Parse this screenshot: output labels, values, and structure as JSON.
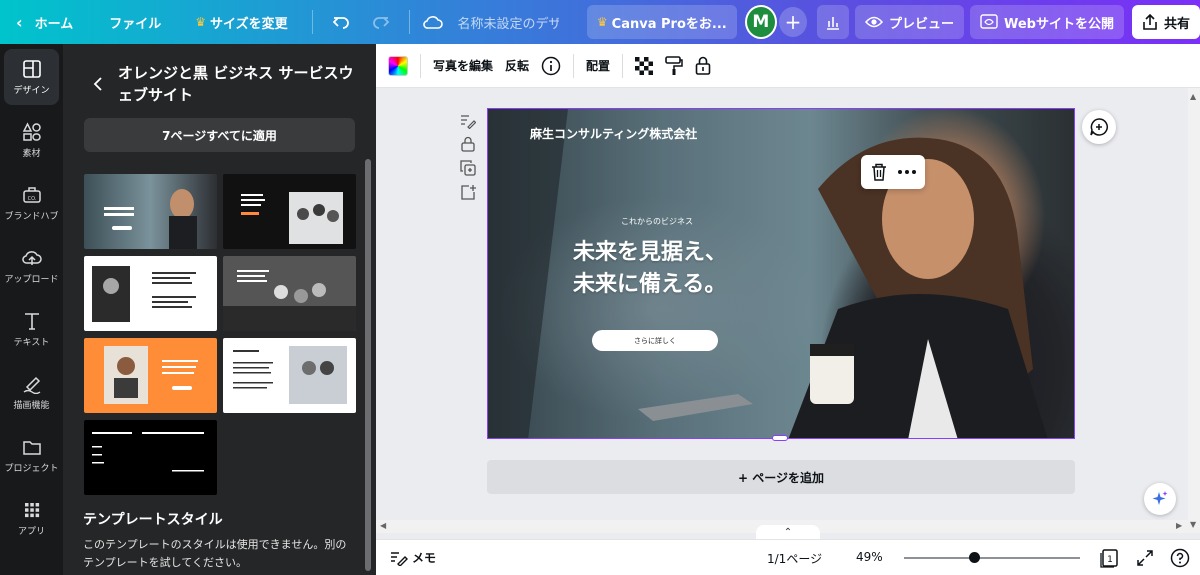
{
  "topbar": {
    "home": "ホーム",
    "file": "ファイル",
    "resize": "サイズを変更",
    "doc_title": "名称未設定のデザ...",
    "pro": "Canva Proをお...",
    "avatar": "M",
    "plus": "+",
    "preview": "プレビュー",
    "publish": "Webサイトを公開",
    "share": "共有"
  },
  "rail": [
    {
      "label": "デザイン",
      "icon": "layout-icon"
    },
    {
      "label": "素材",
      "icon": "shapes-icon"
    },
    {
      "label": "ブランドハブ",
      "icon": "brand-icon"
    },
    {
      "label": "アップロード",
      "icon": "upload-icon"
    },
    {
      "label": "テキスト",
      "icon": "text-icon"
    },
    {
      "label": "描画機能",
      "icon": "draw-icon"
    },
    {
      "label": "プロジェクト",
      "icon": "folder-icon"
    },
    {
      "label": "アプリ",
      "icon": "apps-icon"
    }
  ],
  "panel": {
    "title": "オレンジと黒 ビジネス サービスウェブサイト",
    "apply_all": "7ページすべてに適用",
    "template_style_heading": "テンプレートスタイル",
    "template_style_body": "このテンプレートのスタイルは使用できません。別のテンプレートを試してください。"
  },
  "ctx": {
    "edit_photo": "写真を編集",
    "flip": "反転",
    "position": "配置"
  },
  "hero": {
    "company": "麻生コンサルティング株式会社",
    "sub": "これからのビジネス",
    "headline_1": "未来を見据え、",
    "headline_2": "未来に備える。",
    "cta": "さらに詳しく"
  },
  "canvas": {
    "add_page": "+ ページを追加"
  },
  "bottom": {
    "notes": "メモ",
    "pages": "1/1ページ",
    "zoom": "49%",
    "zoom_value": 49,
    "page_count_icon": "1"
  },
  "colors": {
    "accent": "#8b3dff",
    "rail_bg": "#18191b",
    "panel_bg": "#252627"
  }
}
